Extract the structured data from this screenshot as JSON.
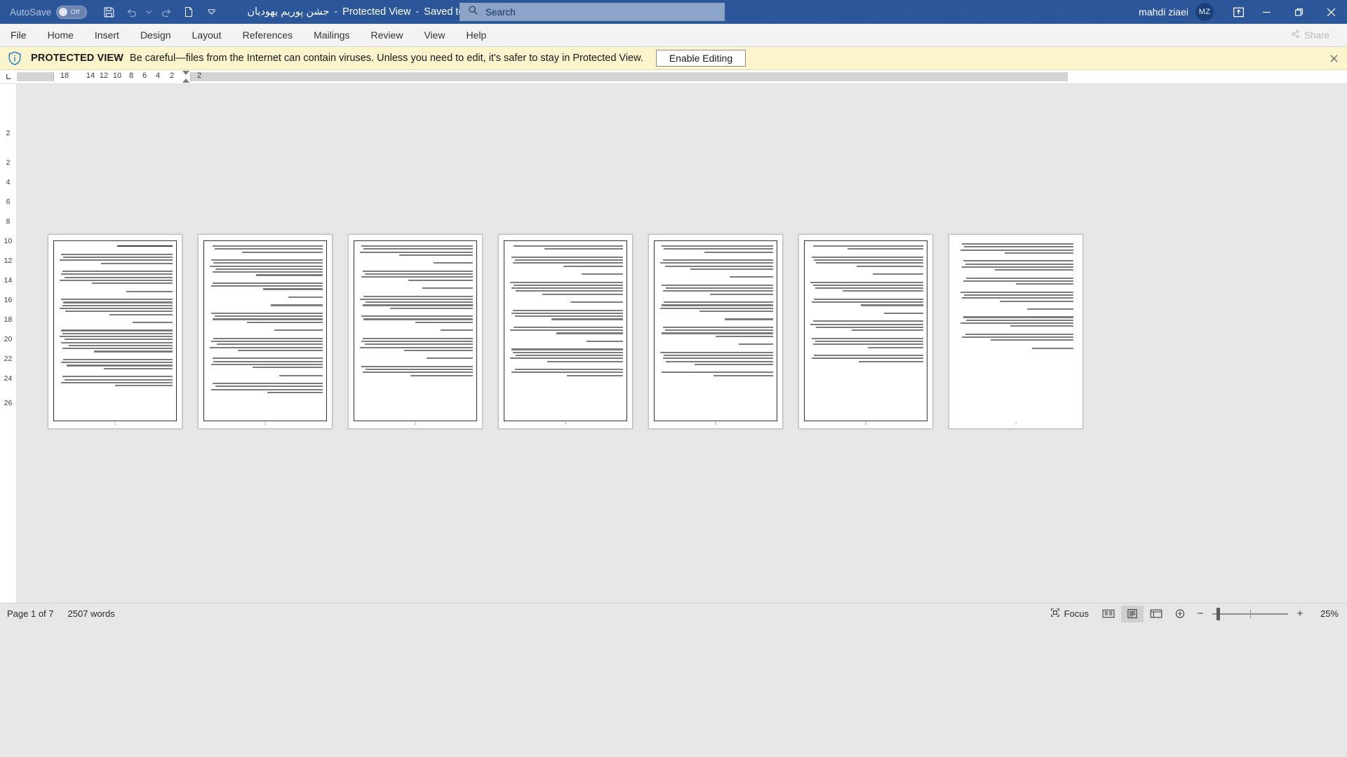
{
  "titlebar": {
    "autosave_label": "AutoSave",
    "autosave_state": "Off",
    "qat": [
      {
        "name": "save-button",
        "icon": "save-icon"
      },
      {
        "name": "undo-button",
        "icon": "undo-icon"
      },
      {
        "name": "redo-button",
        "icon": "redo-icon"
      },
      {
        "name": "new-blank-document-button",
        "icon": "document-icon"
      },
      {
        "name": "customize-quick-access-toolbar-button",
        "icon": "chevron-down-icon"
      }
    ],
    "document_title": "جشن پوریم یهودیان",
    "separator": "-",
    "protected_view_label": "Protected View",
    "saved_state": "Saved to this PC",
    "title_caret": "▾",
    "account_name": "mahdi ziaei",
    "account_initials": "MZ",
    "ribbon_display_icon": "ribbon-display-options-icon",
    "window_minimize": "−",
    "window_restore": "❐",
    "window_close": "✕"
  },
  "search": {
    "icon": "search-icon",
    "placeholder": "Search"
  },
  "ribbon": {
    "tabs": [
      {
        "label": "File"
      },
      {
        "label": "Home"
      },
      {
        "label": "Insert"
      },
      {
        "label": "Design"
      },
      {
        "label": "Layout"
      },
      {
        "label": "References"
      },
      {
        "label": "Mailings"
      },
      {
        "label": "Review"
      },
      {
        "label": "View"
      },
      {
        "label": "Help"
      }
    ],
    "share_label": "Share",
    "share_icon": "share-icon"
  },
  "protected_view": {
    "icon": "shield-info-icon",
    "title": "PROTECTED VIEW",
    "message": "Be careful—files from the Internet can contain viruses. Unless you need to edit, it's safer to stay in Protected View.",
    "enable_button": "Enable Editing",
    "close_icon": "close-icon"
  },
  "ruler": {
    "corner_label": "L",
    "horizontal_ticks": [
      "18",
      "14",
      "12",
      "10",
      "8",
      "6",
      "4",
      "2",
      "2"
    ],
    "vertical_ticks": [
      "2",
      "2",
      "4",
      "6",
      "8",
      "10",
      "12",
      "14",
      "16",
      "18",
      "20",
      "22",
      "24",
      "26"
    ]
  },
  "document": {
    "page_count": 7,
    "page_footer_numbers": [
      "1",
      "2",
      "3",
      "4",
      "5",
      "6",
      "7"
    ]
  },
  "statusbar": {
    "page_indicator": "Page 1 of 7",
    "word_count": "2507 words",
    "proofing_icon": "proofing-errors-icon",
    "focus_label": "Focus",
    "focus_icon": "focus-icon",
    "view_read_mode": "read-mode-icon",
    "view_print_layout": "print-layout-icon",
    "view_web_layout": "web-layout-icon",
    "immersive_reader_icon": "immersive-reader-icon",
    "zoom_out": "−",
    "zoom_in": "+",
    "zoom_level": "25%"
  }
}
